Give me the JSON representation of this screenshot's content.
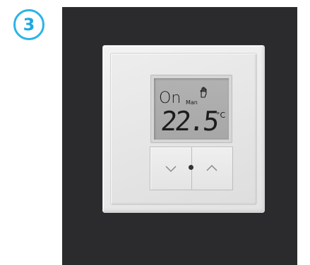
{
  "step": {
    "number": "3"
  },
  "display": {
    "mode": "On",
    "manual_label": "Man",
    "hand_icon": "hand-icon",
    "temperature": "22.5",
    "unit": "°C"
  },
  "buttons": {
    "down_icon": "chevron-down-icon",
    "up_icon": "chevron-up-icon"
  },
  "colors": {
    "accent": "#2ab3e8",
    "wall": "#2b2b2d",
    "frame": "#e9e9e9",
    "lcd": "#acacac"
  }
}
